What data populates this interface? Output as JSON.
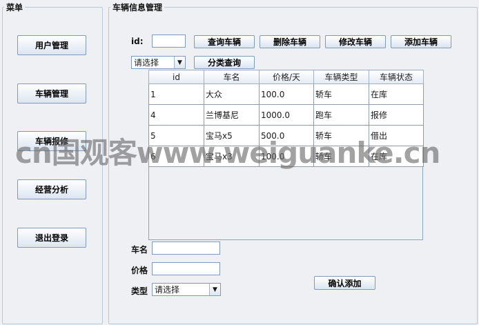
{
  "menu": {
    "title": "菜单",
    "items": [
      "用户管理",
      "车辆管理",
      "车辆报修",
      "经营分析",
      "退出登录"
    ]
  },
  "main": {
    "title": "车辆信息管理",
    "id_label": "id:",
    "id_value": "",
    "buttons": {
      "query": "查询车辆",
      "delete": "删除车辆",
      "modify": "修改车辆",
      "add": "添加车辆"
    },
    "filter_select": "请选择",
    "category_query": "分类查询",
    "table": {
      "headers": [
        "id",
        "车名",
        "价格/天",
        "车辆类型",
        "车辆状态"
      ],
      "rows": [
        [
          "1",
          "大众",
          "100.0",
          "轿车",
          "在库"
        ],
        [
          "4",
          "兰博基尼",
          "1000.0",
          "跑车",
          "报修"
        ],
        [
          "5",
          "宝马x5",
          "500.0",
          "轿车",
          "借出"
        ],
        [
          "6",
          "宝马x3",
          "100.0",
          "轿车",
          "在库"
        ]
      ]
    },
    "form": {
      "name_label": "车名",
      "name_value": "",
      "price_label": "价格",
      "price_value": "",
      "type_label": "类型",
      "type_select": "请选择",
      "confirm": "确认添加"
    }
  },
  "watermark": "cn国观客www.weiguanke.cn"
}
